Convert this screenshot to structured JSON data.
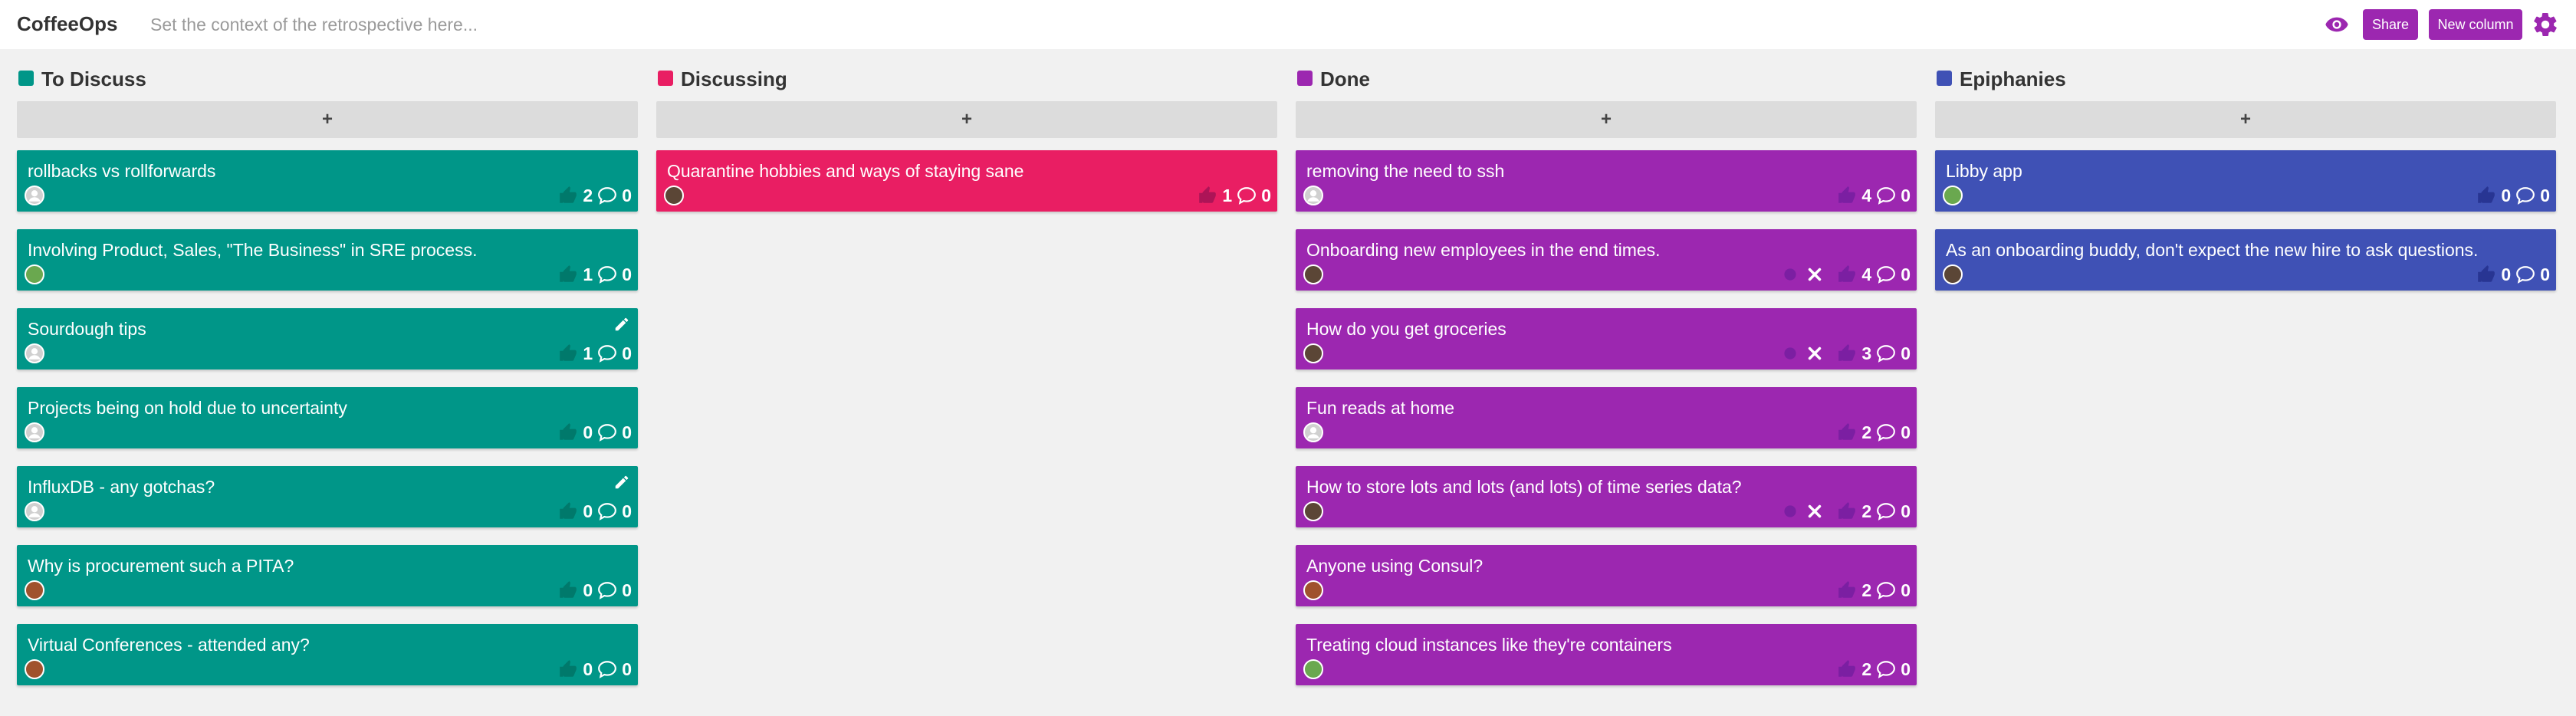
{
  "header": {
    "app_title": "CoffeeOps",
    "context_placeholder": "Set the context of the retrospective here...",
    "icons": {
      "eye": "eye-icon",
      "settings": "gear-icon"
    },
    "share_label": "Share",
    "new_column_label": "New column"
  },
  "add_label": "+",
  "colors": {
    "accent": "#9c27b0",
    "to_discuss": "#009688",
    "discussing": "#e91e63",
    "done": "#9c27b0",
    "epiphanies": "#3f51b5"
  },
  "columns": [
    {
      "title": "To Discuss",
      "cards": [
        {
          "text": "rollbacks vs rollforwards",
          "votes": "2",
          "comments": "0"
        },
        {
          "text": "Involving Product, Sales, \"The Business\" in SRE process.",
          "votes": "1",
          "comments": "0"
        },
        {
          "text": "Sourdough tips",
          "votes": "1",
          "comments": "0"
        },
        {
          "text": "Projects being on hold due to uncertainty",
          "votes": "0",
          "comments": "0"
        },
        {
          "text": "InfluxDB - any gotchas?",
          "votes": "0",
          "comments": "0"
        },
        {
          "text": "Why is procurement such a PITA?",
          "votes": "0",
          "comments": "0"
        },
        {
          "text": "Virtual Conferences - attended any?",
          "votes": "0",
          "comments": "0"
        }
      ]
    },
    {
      "title": "Discussing",
      "cards": [
        {
          "text": "Quarantine hobbies and ways of staying sane",
          "votes": "1",
          "comments": "0"
        }
      ]
    },
    {
      "title": "Done",
      "cards": [
        {
          "text": "removing the need to ssh",
          "votes": "4",
          "comments": "0"
        },
        {
          "text": "Onboarding new employees in the end times.",
          "votes": "4",
          "comments": "0"
        },
        {
          "text": "How do you get groceries",
          "votes": "3",
          "comments": "0"
        },
        {
          "text": "Fun reads at home",
          "votes": "2",
          "comments": "0"
        },
        {
          "text": "How to store lots and lots (and lots) of time series data?",
          "votes": "2",
          "comments": "0"
        },
        {
          "text": "Anyone using Consul?",
          "votes": "2",
          "comments": "0"
        },
        {
          "text": "Treating cloud instances like they're containers",
          "votes": "2",
          "comments": "0"
        }
      ]
    },
    {
      "title": "Epiphanies",
      "cards": [
        {
          "text": "Libby app",
          "votes": "0",
          "comments": "0"
        },
        {
          "text": "As an onboarding buddy, don't expect the new hire to ask questions.",
          "votes": "0",
          "comments": "0"
        }
      ]
    }
  ]
}
